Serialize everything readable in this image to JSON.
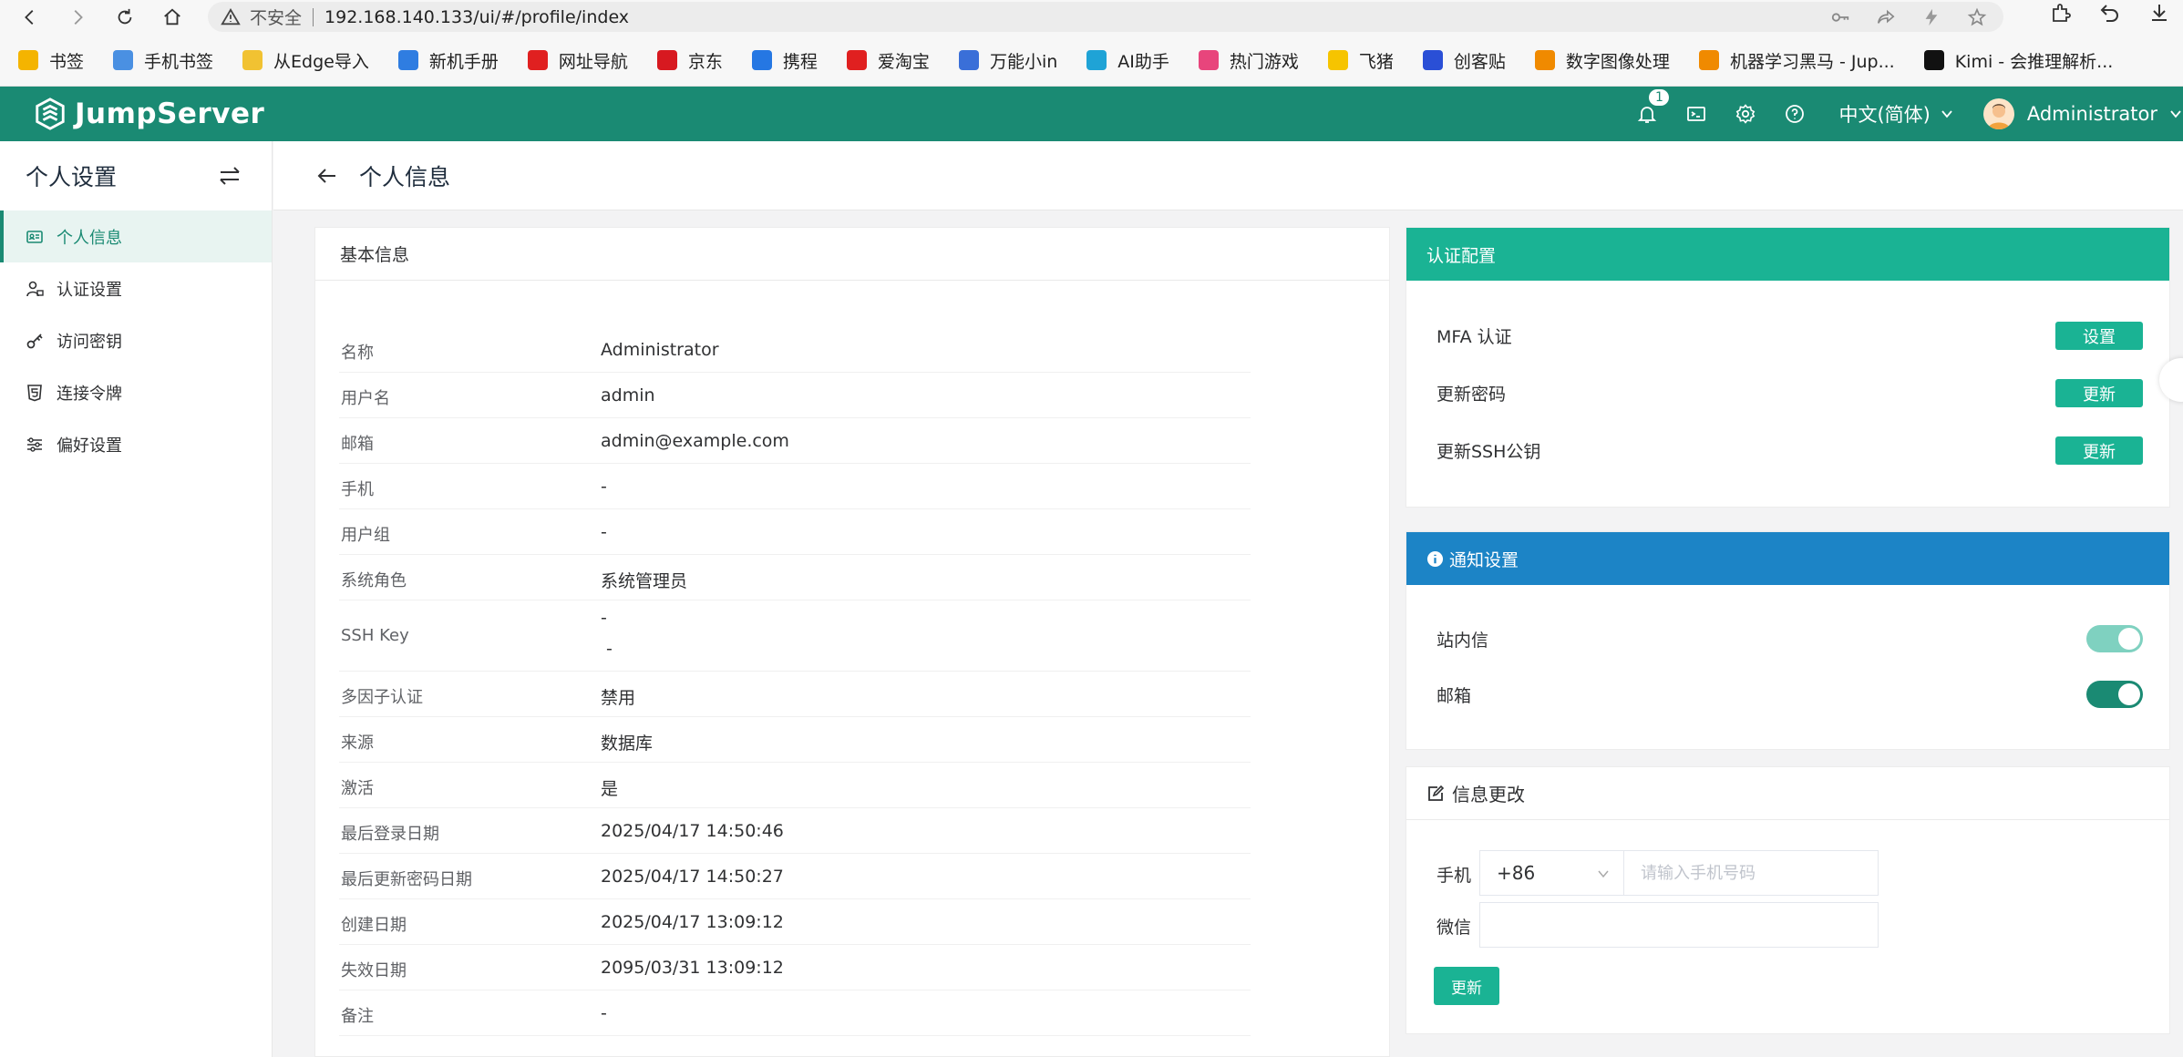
{
  "browser": {
    "insecure_label": "不安全",
    "url": "192.168.140.133/ui/#/profile/index",
    "bookmarks": [
      {
        "label": "书签",
        "icon": "star-icon",
        "color": "#f4b400"
      },
      {
        "label": "手机书签",
        "icon": "phone-bookmark-icon",
        "color": "#4a90e2"
      },
      {
        "label": "从Edge导入",
        "icon": "folder-icon",
        "color": "#f1c232"
      },
      {
        "label": "新机手册",
        "icon": "manual-icon",
        "color": "#2f7de1"
      },
      {
        "label": "网址导航",
        "icon": "navigation-icon",
        "color": "#e02020"
      },
      {
        "label": "京东",
        "icon": "jd-icon",
        "color": "#d71920"
      },
      {
        "label": "携程",
        "icon": "ctrip-icon",
        "color": "#2577e3"
      },
      {
        "label": "爱淘宝",
        "icon": "taobao-icon",
        "color": "#e02020"
      },
      {
        "label": "万能小in",
        "icon": "robot-icon",
        "color": "#3a6fd8"
      },
      {
        "label": "AI助手",
        "icon": "edge-ai-icon",
        "color": "#1fa3d6"
      },
      {
        "label": "热门游戏",
        "icon": "game-icon",
        "color": "#e8457c"
      },
      {
        "label": "飞猪",
        "icon": "fliggy-icon",
        "color": "#f6c400"
      },
      {
        "label": "创客贴",
        "icon": "chuangkit-icon",
        "color": "#2a4fd6"
      },
      {
        "label": "数字图像处理",
        "icon": "book-icon",
        "color": "#f08a00"
      },
      {
        "label": "机器学习黑马 - Jup...",
        "icon": "book-icon",
        "color": "#f08a00"
      },
      {
        "label": "Kimi - 会推理解析...",
        "icon": "kimi-icon",
        "color": "#111111"
      }
    ]
  },
  "header": {
    "brand": "JumpServer",
    "notification_count": "1",
    "language": "中文(简体)",
    "user": "Administrator"
  },
  "sidebar": {
    "title": "个人设置",
    "items": [
      {
        "label": "个人信息",
        "icon": "id-card-icon",
        "active": true
      },
      {
        "label": "认证设置",
        "icon": "user-lock-icon",
        "active": false
      },
      {
        "label": "访问密钥",
        "icon": "key-icon",
        "active": false
      },
      {
        "label": "连接令牌",
        "icon": "html5-icon",
        "active": false
      },
      {
        "label": "偏好设置",
        "icon": "sliders-icon",
        "active": false
      }
    ]
  },
  "page": {
    "title": "个人信息"
  },
  "basic_info": {
    "title": "基本信息",
    "rows": [
      {
        "label": "名称",
        "value": "Administrator"
      },
      {
        "label": "用户名",
        "value": "admin"
      },
      {
        "label": "邮箱",
        "value": "admin@example.com"
      },
      {
        "label": "手机",
        "value": "-"
      },
      {
        "label": "用户组",
        "value": "-"
      },
      {
        "label": "系统角色",
        "value": "系统管理员"
      },
      {
        "label": "SSH Key",
        "value": "-",
        "value2": "-"
      },
      {
        "label": "多因子认证",
        "value": "禁用"
      },
      {
        "label": "来源",
        "value": "数据库"
      },
      {
        "label": "激活",
        "value": "是"
      },
      {
        "label": "最后登录日期",
        "value": "2025/04/17 14:50:46"
      },
      {
        "label": "最后更新密码日期",
        "value": "2025/04/17 14:50:27"
      },
      {
        "label": "创建日期",
        "value": "2025/04/17 13:09:12"
      },
      {
        "label": "失效日期",
        "value": "2095/03/31 13:09:12"
      },
      {
        "label": "备注",
        "value": "-"
      }
    ]
  },
  "auth_config": {
    "title": "认证配置",
    "rows": [
      {
        "label": "MFA 认证",
        "button": "设置"
      },
      {
        "label": "更新密码",
        "button": "更新"
      },
      {
        "label": "更新SSH公钥",
        "button": "更新"
      }
    ]
  },
  "notice": {
    "title": "通知设置",
    "rows": [
      {
        "label": "站内信",
        "enabled": true,
        "color": "#7fd1c0"
      },
      {
        "label": "邮箱",
        "enabled": true,
        "color": "#1a8a73"
      }
    ]
  },
  "modify": {
    "title": "信息更改",
    "phone_label": "手机",
    "country_code": "+86",
    "phone_placeholder": "请输入手机号码",
    "wechat_label": "微信",
    "submit": "更新"
  },
  "colors": {
    "brand": "#1a8a73",
    "green_header": "#1ab394",
    "blue_header": "#1c84c6"
  }
}
